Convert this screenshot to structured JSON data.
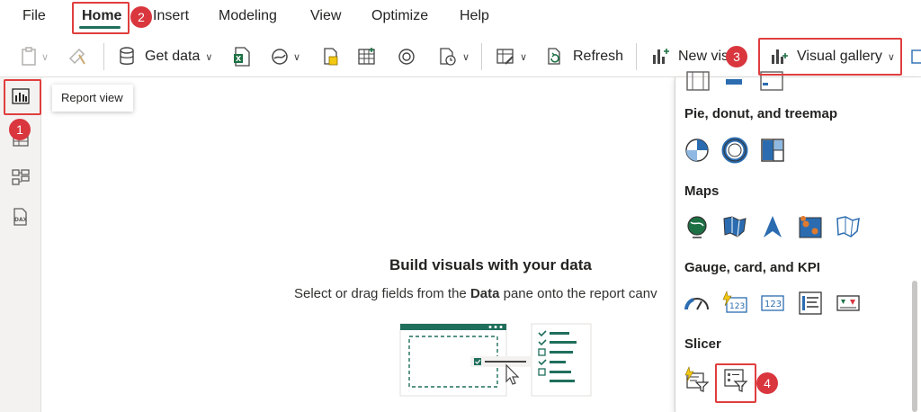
{
  "menu": {
    "tabs": [
      "File",
      "Home",
      "Insert",
      "Modeling",
      "View",
      "Optimize",
      "Help"
    ],
    "active_tab": "Home"
  },
  "ribbon": {
    "get_data_label": "Get data",
    "refresh_label": "Refresh",
    "new_visual_label": "New vis",
    "visual_gallery_label": "Visual gallery"
  },
  "tooltip": {
    "text": "Report view"
  },
  "canvas": {
    "title": "Build visuals with your data",
    "subtitle_pre": "Select or drag fields from the ",
    "subtitle_bold": "Data",
    "subtitle_post": " pane onto the report canv"
  },
  "gallery": {
    "sections": [
      {
        "title": "Pie, donut, and treemap",
        "icons": [
          "pie-chart-icon",
          "donut-chart-icon",
          "treemap-icon"
        ]
      },
      {
        "title": "Maps",
        "icons": [
          "map-globe-icon",
          "filled-map-icon",
          "azure-map-icon",
          "arcgis-map-icon",
          "shape-map-icon"
        ]
      },
      {
        "title": "Gauge, card, and KPI",
        "icons": [
          "gauge-icon",
          "card-new-icon",
          "card-icon",
          "multi-row-card-icon",
          "kpi-icon"
        ]
      },
      {
        "title": "Slicer",
        "icons": [
          "slicer-new-icon",
          "slicer-icon"
        ]
      }
    ]
  },
  "badges": [
    "1",
    "2",
    "3",
    "4"
  ],
  "colors": {
    "accent": "#1f6f5c",
    "highlight": "#e03e3e",
    "icon_blue": "#2b6cb0"
  }
}
